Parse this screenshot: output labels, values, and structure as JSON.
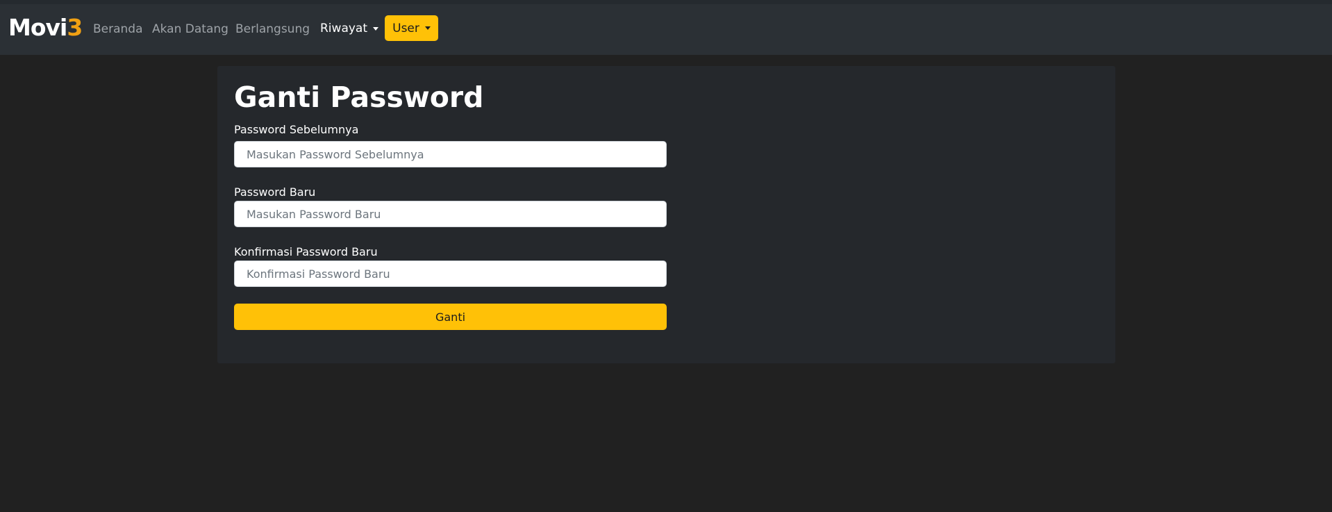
{
  "navbar": {
    "brand_main": "Movi",
    "brand_accent": "3",
    "links": [
      "Beranda",
      "Akan Datang",
      "Berlangsung"
    ],
    "history_dropdown": "Riwayat",
    "user_button": "User"
  },
  "form": {
    "title": "Ganti Password",
    "fields": [
      {
        "label": "Password Sebelumnya",
        "placeholder": "Masukan Password Sebelumnya",
        "value": ""
      },
      {
        "label": "Password Baru",
        "placeholder": "Masukan Password Baru",
        "value": ""
      },
      {
        "label": "Konfirmasi Password Baru",
        "placeholder": "Konfirmasi Password Baru",
        "value": ""
      }
    ],
    "submit_label": "Ganti"
  },
  "colors": {
    "accent": "#ffc107",
    "brand_accent": "#f0a013",
    "navbar_bg": "#2b3035",
    "page_bg": "#212121",
    "card_bg": "#25282c"
  }
}
